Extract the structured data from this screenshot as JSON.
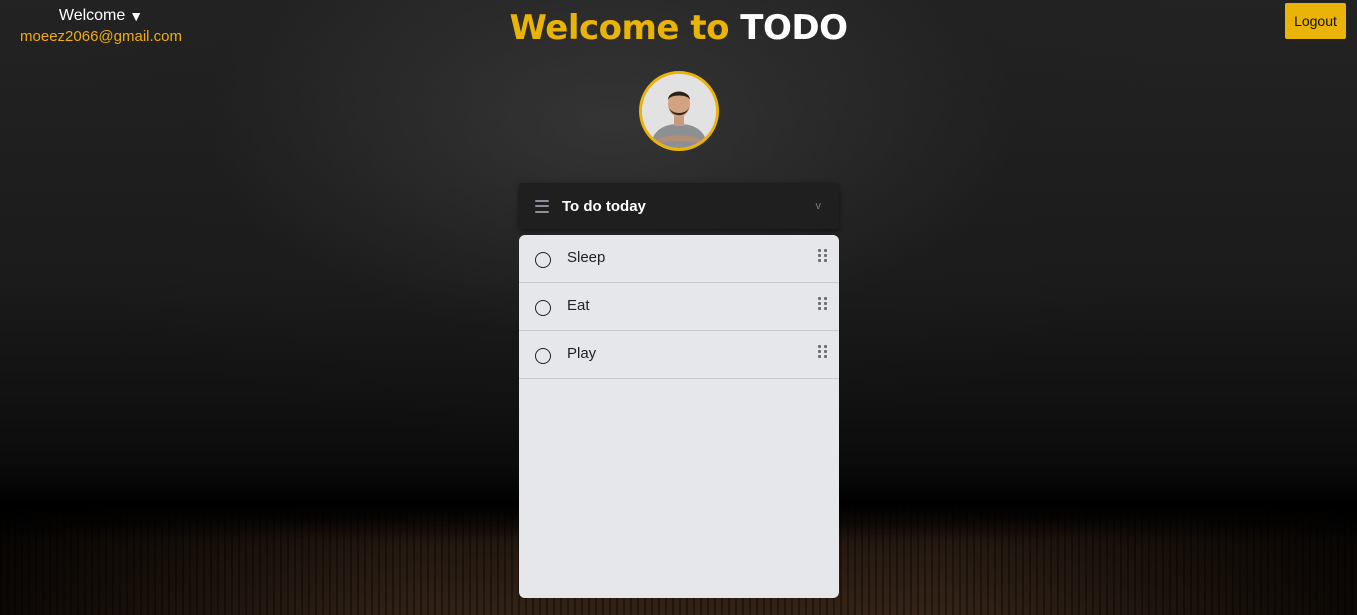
{
  "user": {
    "welcome_label": "Welcome",
    "caret": "▼",
    "email": "moeez2066@gmail.com"
  },
  "header": {
    "title_part1": "Welcome to",
    "title_part2": "TODO",
    "logout_label": "Logout"
  },
  "list": {
    "title": "To do today",
    "chevron": "v",
    "menu_icon": "hamburger-icon",
    "tasks": [
      {
        "label": "Sleep"
      },
      {
        "label": "Eat"
      },
      {
        "label": "Play"
      }
    ]
  },
  "colors": {
    "accent": "#eab308",
    "card_bg": "#e6e7ea",
    "header_bg": "#1f1f1f"
  }
}
